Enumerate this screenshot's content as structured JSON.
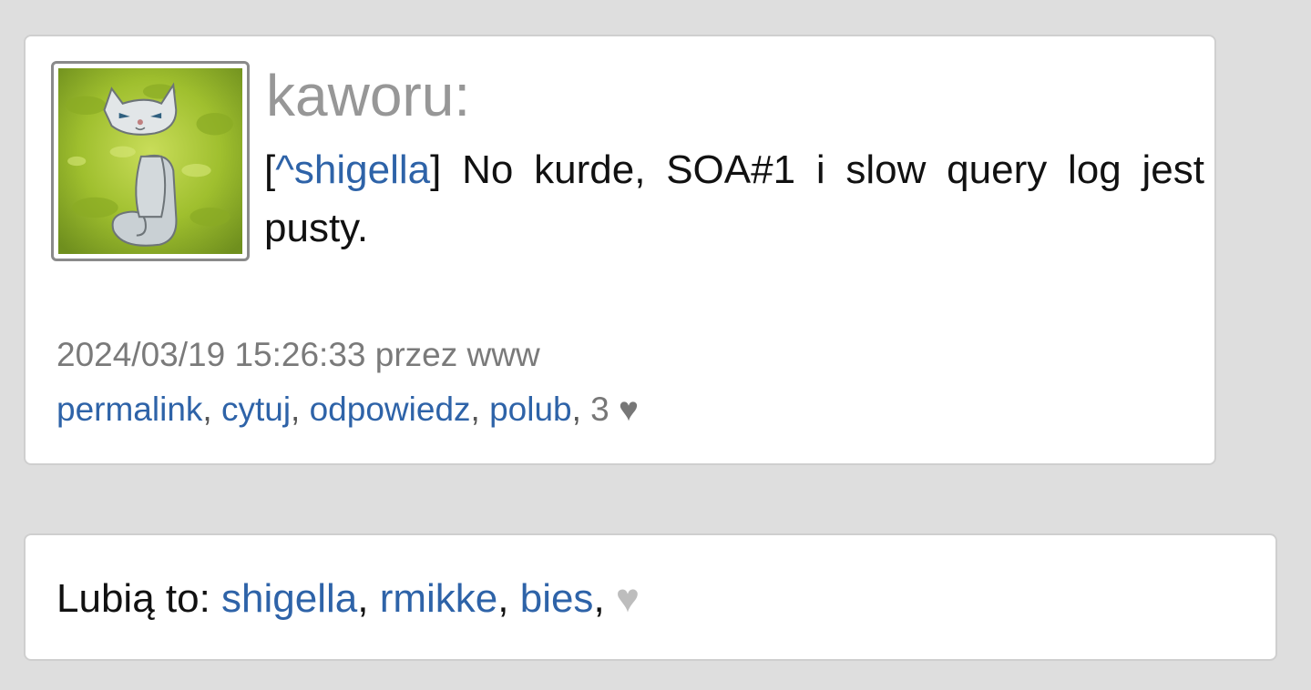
{
  "post": {
    "author": "kaworu:",
    "avatar_icon": "cat-avatar-icon",
    "text": {
      "open_bracket": "[",
      "mention": "^shigella",
      "close_bracket": "]",
      "body": " No kurde, SOA#1 i slow query log jest pusty."
    },
    "meta": "2024/03/19 15:26:33 przez www",
    "actions": {
      "permalink": "permalink",
      "cite": "cytuj",
      "reply": "odpowiedz",
      "like": "polub",
      "like_count": "3",
      "heart": "♥"
    }
  },
  "likes": {
    "label": "Lubią to: ",
    "users": [
      "shigella",
      "rmikke",
      "bies"
    ],
    "heart": "♥"
  },
  "colors": {
    "background": "#dedede",
    "card": "#ffffff",
    "link": "#2e63a8",
    "author": "#979797",
    "meta": "#7a7a7a"
  }
}
